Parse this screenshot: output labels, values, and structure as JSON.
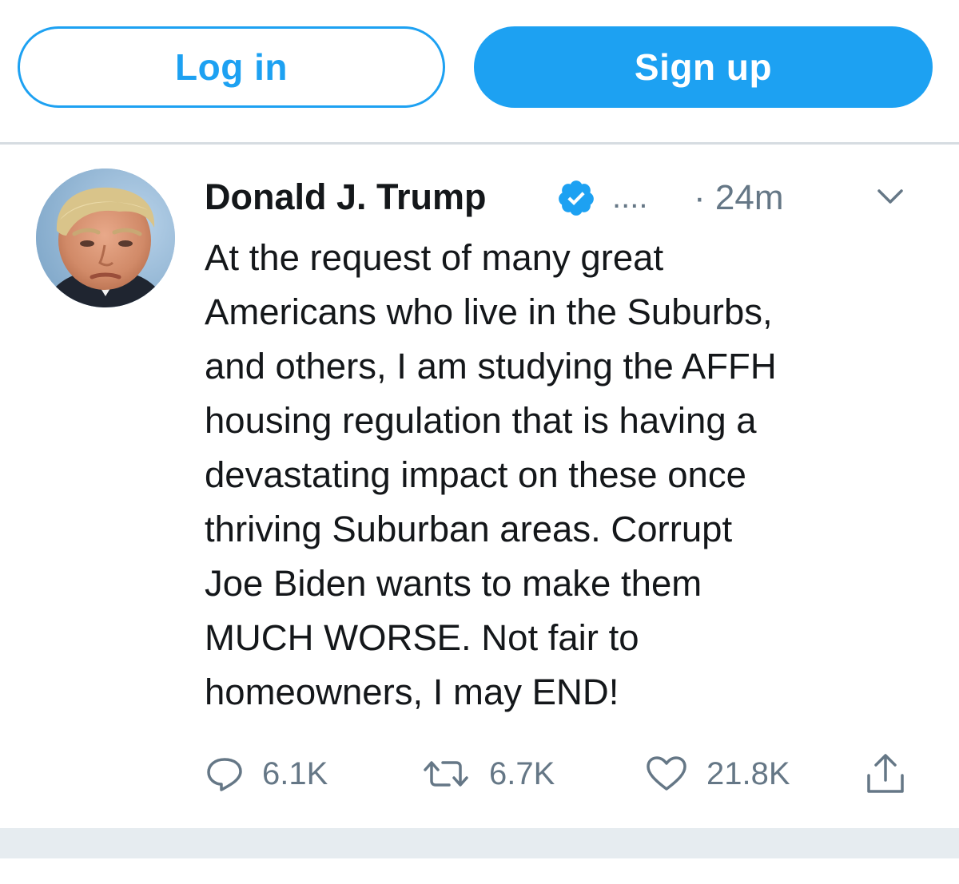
{
  "auth": {
    "login_label": "Log in",
    "signup_label": "Sign up"
  },
  "colors": {
    "accent": "#1da1f2",
    "text": "#14171a",
    "muted": "#657786",
    "divider": "#d6dce1",
    "footer": "#e6ecf0"
  },
  "tweet": {
    "author_name": "Donald J. Trump",
    "handle_truncated": "....",
    "time": "· 24m",
    "text": "At the request of many great\nAmericans who live in the Suburbs,\nand others, I am studying the AFFH\nhousing regulation that is having a\ndevastating impact on these once\nthriving Suburban areas. Corrupt\nJoe Biden wants to make them\nMUCH WORSE. Not fair to\nhomeowners, I may END!",
    "actions": {
      "replies": "6.1K",
      "retweets": "6.7K",
      "likes": "21.8K"
    },
    "icons": [
      "verified-badge-icon",
      "chevron-down-icon",
      "reply-icon",
      "retweet-icon",
      "like-icon",
      "share-icon"
    ]
  }
}
